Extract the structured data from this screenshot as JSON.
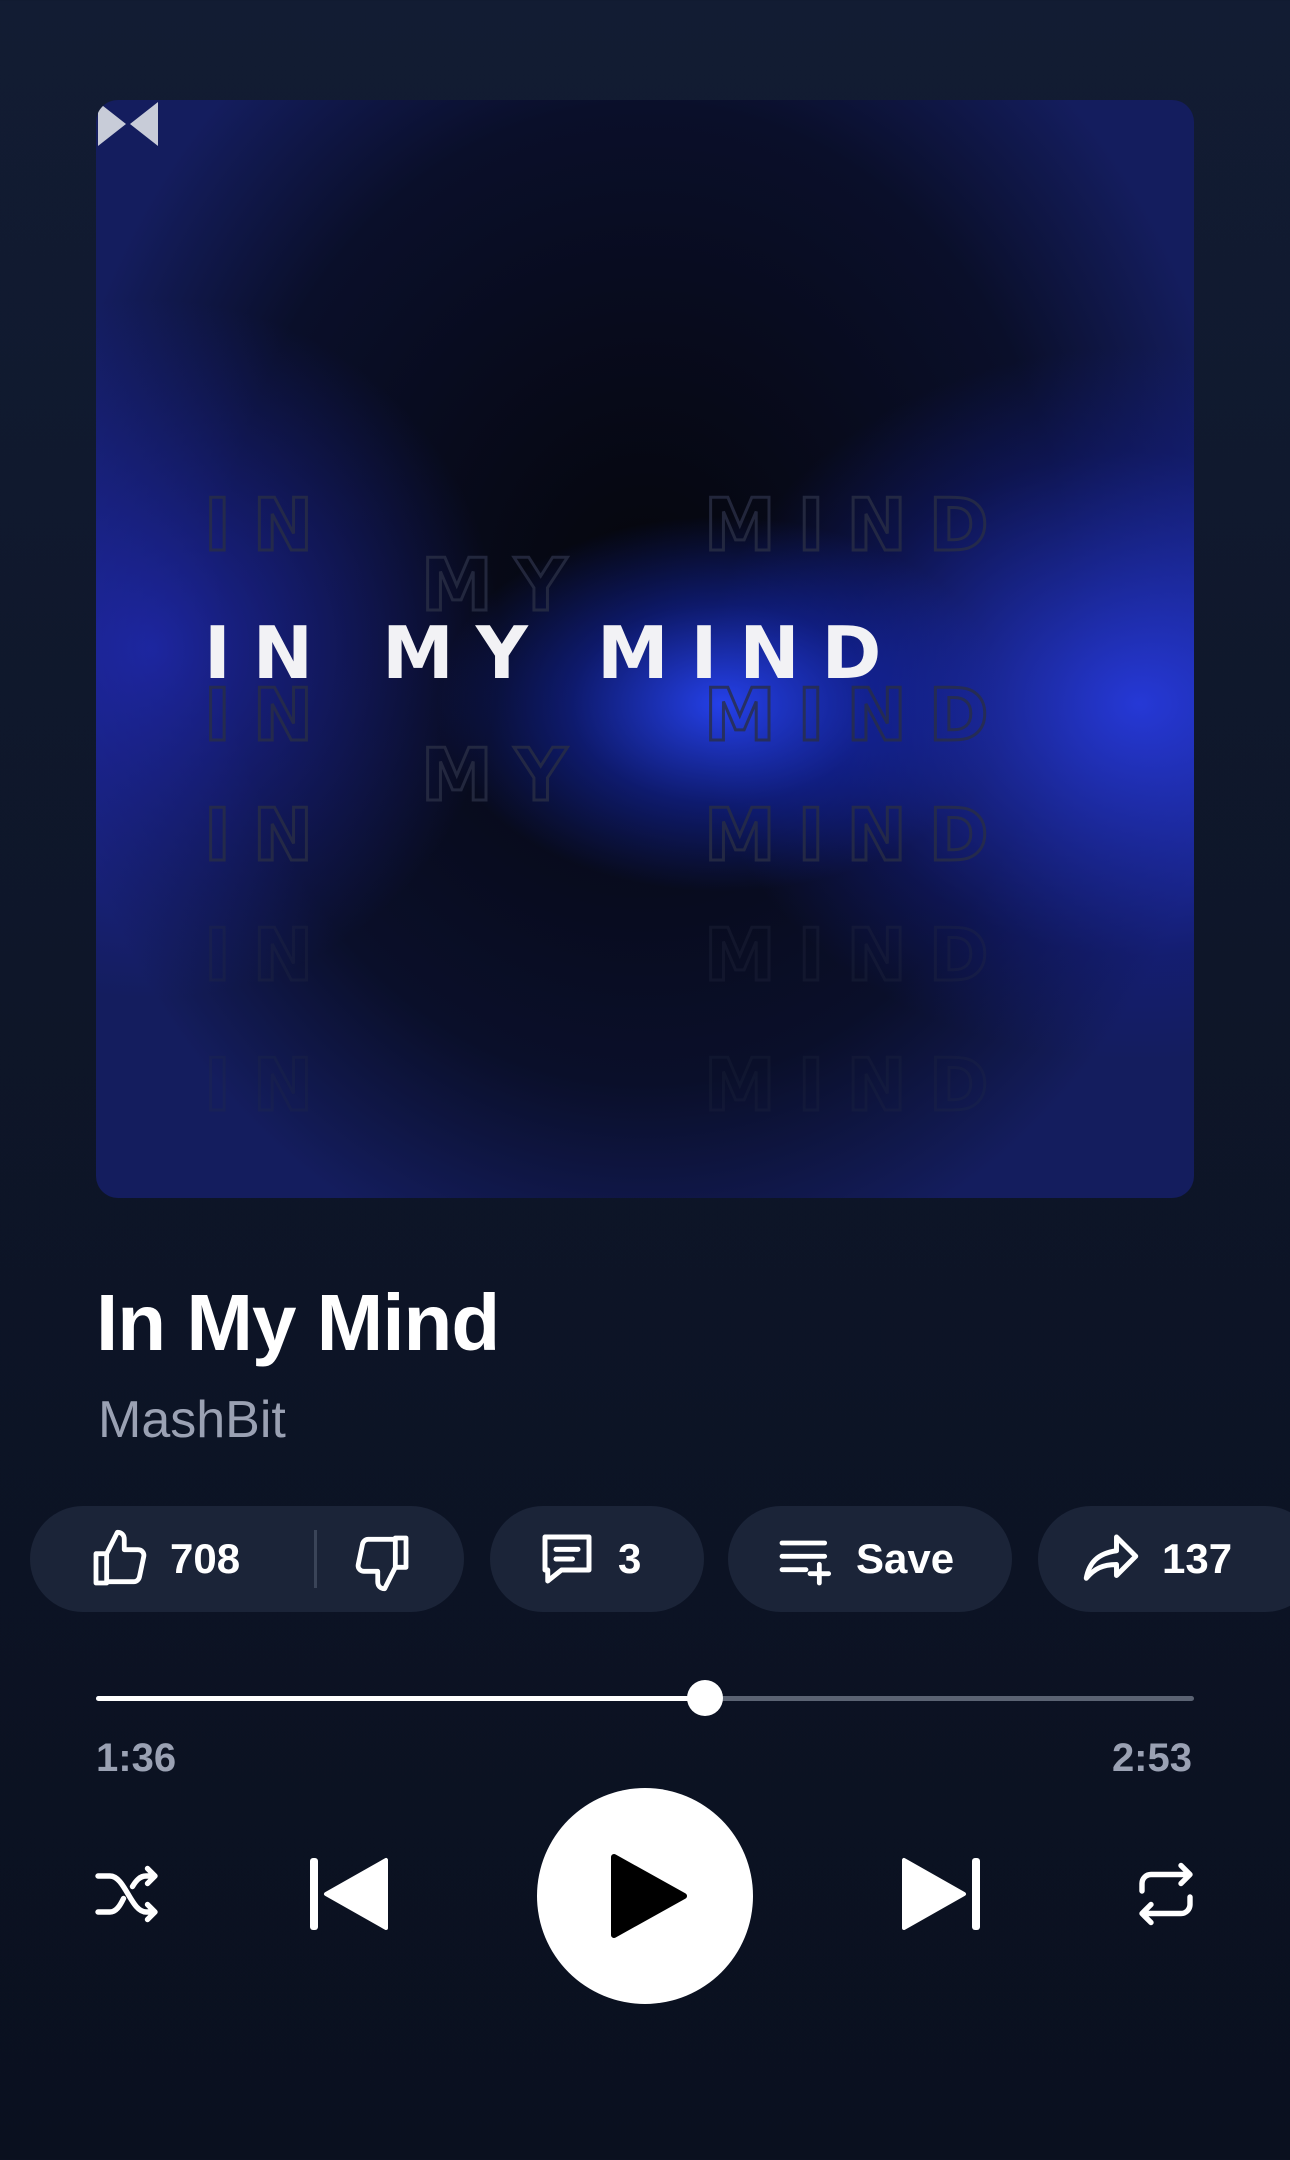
{
  "album_art": {
    "cover_text": "IN MY MIND",
    "cover_words": [
      "IN",
      "MY",
      "MIND"
    ],
    "logo_icon": "bowtie-logo-icon"
  },
  "track": {
    "title": "In My Mind",
    "artist": "MashBit"
  },
  "actions": {
    "likes": "708",
    "comments": "3",
    "save_label": "Save",
    "shares": "137"
  },
  "playback": {
    "current_time": "1:36",
    "total_time": "2:53",
    "progress_fraction": 0.555
  },
  "controls": {
    "icons": [
      "shuffle-icon",
      "previous-icon",
      "play-icon",
      "next-icon",
      "repeat-icon"
    ]
  },
  "colors": {
    "background": "#0e1629",
    "chip": "#1b2438",
    "secondary_text": "#9aa1b3",
    "accent": "#2846ff"
  }
}
